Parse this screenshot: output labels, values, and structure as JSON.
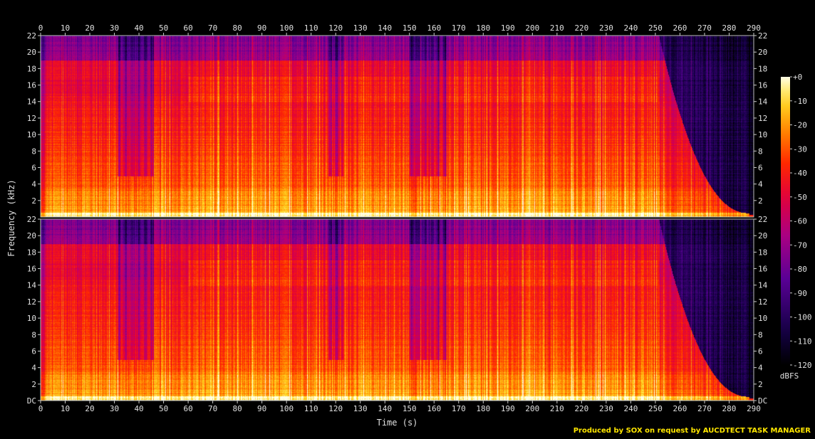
{
  "chart_data": {
    "type": "heatmap",
    "title": "",
    "xlabel": "Time (s)",
    "ylabel": "Frequency (kHz)",
    "xlim": [
      0,
      290
    ],
    "ylim": [
      0,
      22
    ],
    "x_ticks": [
      "0",
      "10",
      "20",
      "30",
      "40",
      "50",
      "60",
      "70",
      "80",
      "90",
      "100",
      "110",
      "120",
      "130",
      "140",
      "150",
      "160",
      "170",
      "180",
      "190",
      "200",
      "210",
      "220",
      "230",
      "240",
      "250",
      "260",
      "270",
      "280",
      "290"
    ],
    "y_ticks": [
      "DC",
      "2",
      "4",
      "6",
      "8",
      "10",
      "12",
      "14",
      "16",
      "18",
      "20",
      "22"
    ],
    "channels": 2,
    "colorbar": {
      "label": "dBFS",
      "ticks": [
        "+0",
        "-10",
        "-20",
        "-30",
        "-40",
        "-50",
        "-60",
        "-70",
        "-80",
        "-90",
        "-100",
        "-110",
        "-120"
      ],
      "range": [
        -120,
        0
      ]
    },
    "features": {
      "quiet_gaps_s": [
        [
          31,
          46
        ],
        [
          117,
          123
        ],
        [
          150,
          165
        ]
      ],
      "fade_out_start_s": 251,
      "fade_out_end_s": 288,
      "upper_band_boost_start_s": 60
    }
  },
  "footer": {
    "text": "Produced by SOX on request by AUCDTECT TASK MANAGER"
  },
  "colors": {
    "background": "#000000",
    "text": "#e0e0e0",
    "footer": "#ffe600"
  }
}
